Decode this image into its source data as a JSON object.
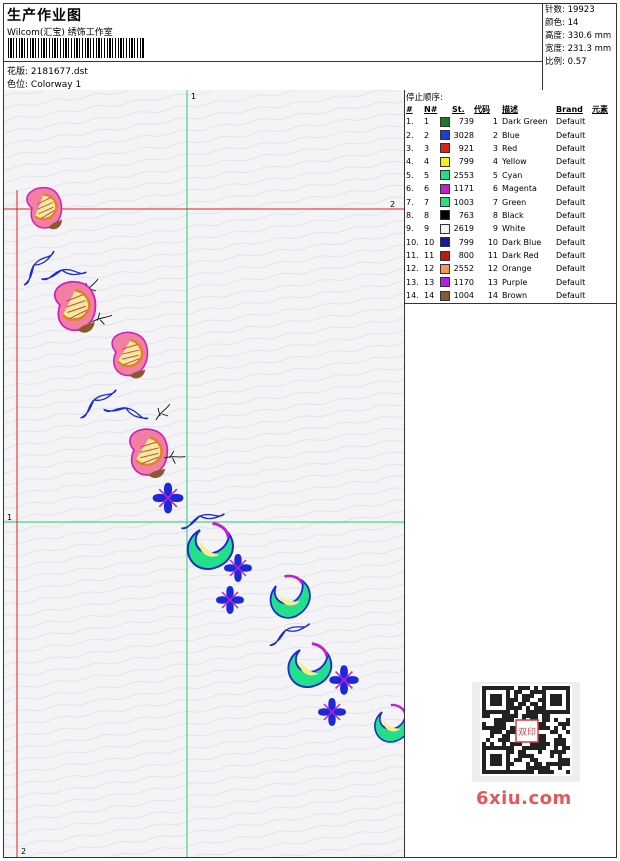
{
  "header": {
    "title": "生产作业图",
    "company": "Wilcom(汇宝) 绣饰工作室",
    "file_label": "花版:",
    "file_value": "2181677.dst",
    "colorway_label": "色位:",
    "colorway_value": "Colorway 1"
  },
  "stats": [
    {
      "label": "针数:",
      "value": "19923"
    },
    {
      "label": "颜色:",
      "value": "14"
    },
    {
      "label": "高度:",
      "value": "330.6 mm"
    },
    {
      "label": "宽度:",
      "value": "231.3 mm"
    },
    {
      "label": "比例:",
      "value": "0.57"
    }
  ],
  "stop_sequence": {
    "title": "停止顺序:",
    "columns": [
      "#",
      "N#",
      "St.",
      "代码",
      "描述",
      "Brand",
      "元素"
    ],
    "rows": [
      {
        "idx": "1.",
        "n": "1",
        "color": "#1a7a2a",
        "st": "739",
        "code": "1",
        "desc": "Dark Green",
        "brand": "Default"
      },
      {
        "idx": "2.",
        "n": "2",
        "color": "#1a3fd6",
        "st": "3028",
        "code": "2",
        "desc": "Blue",
        "brand": "Default"
      },
      {
        "idx": "3.",
        "n": "3",
        "color": "#d8231f",
        "st": "921",
        "code": "3",
        "desc": "Red",
        "brand": "Default"
      },
      {
        "idx": "4.",
        "n": "4",
        "color": "#f5ee1f",
        "st": "799",
        "code": "4",
        "desc": "Yellow",
        "brand": "Default"
      },
      {
        "idx": "5.",
        "n": "5",
        "color": "#22e089",
        "st": "2553",
        "code": "5",
        "desc": "Cyan",
        "brand": "Default"
      },
      {
        "idx": "6.",
        "n": "6",
        "color": "#c21fcf",
        "st": "1171",
        "code": "6",
        "desc": "Magenta",
        "brand": "Default"
      },
      {
        "idx": "7.",
        "n": "7",
        "color": "#2ee07a",
        "st": "1003",
        "code": "7",
        "desc": "Green",
        "brand": "Default"
      },
      {
        "idx": "8.",
        "n": "8",
        "color": "#000000",
        "st": "763",
        "code": "8",
        "desc": "Black",
        "brand": "Default"
      },
      {
        "idx": "9.",
        "n": "9",
        "color": "#f4f4f4",
        "st": "2619",
        "code": "9",
        "desc": "White",
        "brand": "Default"
      },
      {
        "idx": "10.",
        "n": "10",
        "color": "#101a9a",
        "st": "799",
        "code": "10",
        "desc": "Dark Blue",
        "brand": "Default"
      },
      {
        "idx": "11.",
        "n": "11",
        "color": "#c01818",
        "st": "800",
        "code": "11",
        "desc": "Dark Red",
        "brand": "Default"
      },
      {
        "idx": "12.",
        "n": "12",
        "color": "#f29a55",
        "st": "2552",
        "code": "12",
        "desc": "Orange",
        "brand": "Default"
      },
      {
        "idx": "13.",
        "n": "13",
        "color": "#b61fe0",
        "st": "1170",
        "code": "13",
        "desc": "Purple",
        "brand": "Default"
      },
      {
        "idx": "14.",
        "n": "14",
        "color": "#8a5a2e",
        "st": "1004",
        "code": "14",
        "desc": "Brown",
        "brand": "Default"
      }
    ]
  },
  "canvas": {
    "axis_labels": {
      "top": "1",
      "left": "1",
      "right": "2",
      "bottom": "2"
    },
    "guide_colors": {
      "green": "#22cc66",
      "red": "#dd2222"
    }
  },
  "watermark": "6xiu.com",
  "qr_seal": "双印"
}
